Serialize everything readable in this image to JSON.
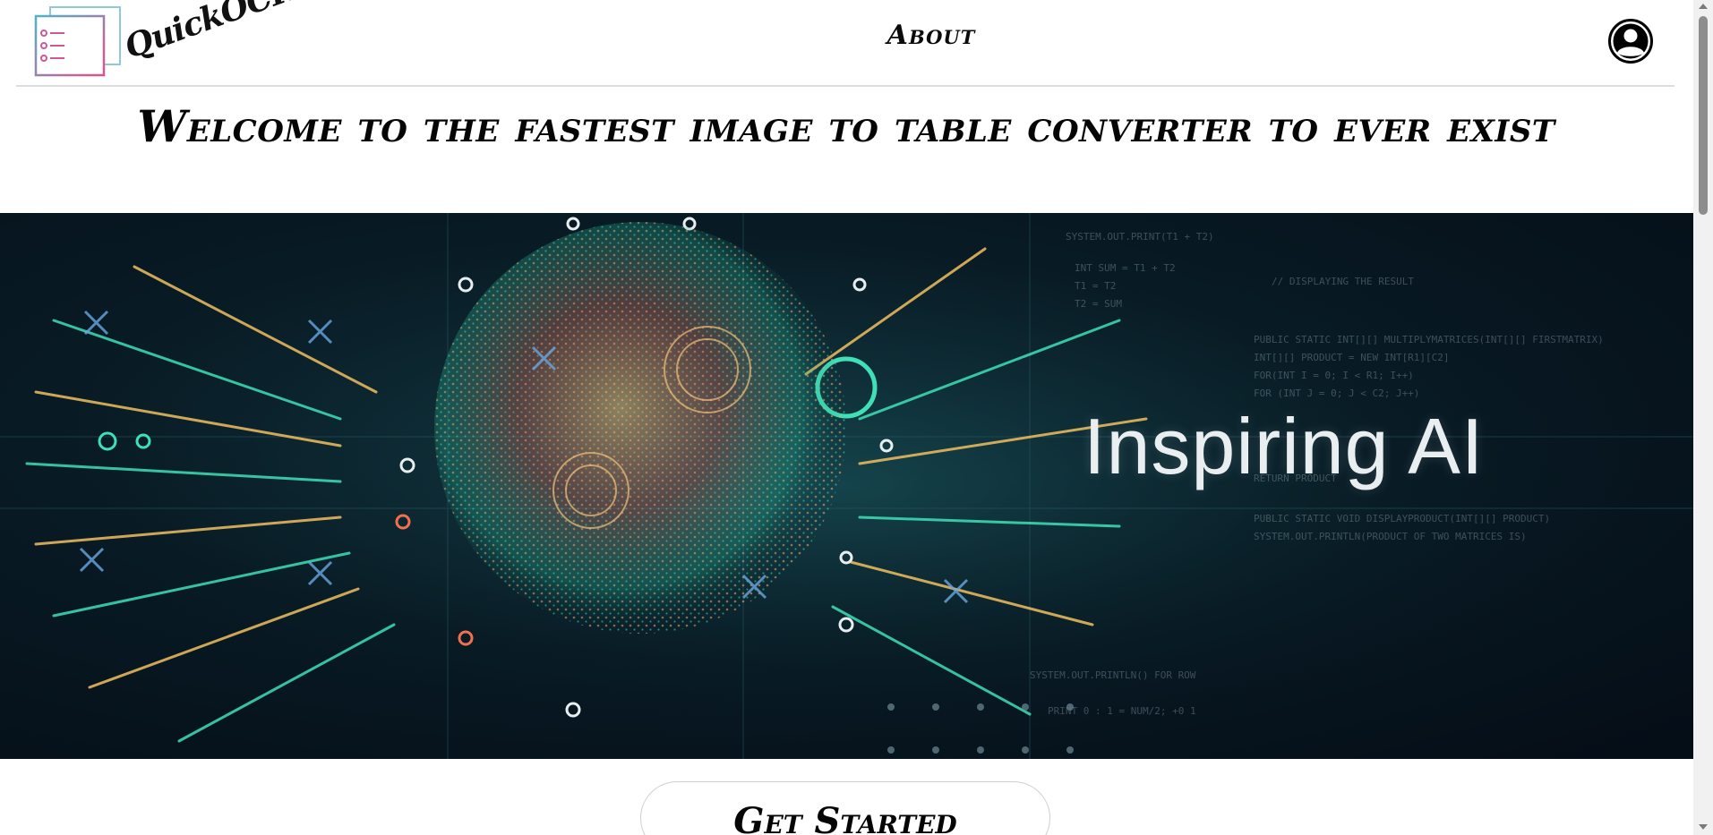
{
  "app": {
    "brand_name": "QuickOCR"
  },
  "nav": {
    "about_label": "About",
    "profile_icon": "user-circle-icon"
  },
  "headline": {
    "text": "Welcome to the fastest image to table converter to ever exist"
  },
  "hero": {
    "caption": "Inspiring AI",
    "image_icon": "ai-particle-sphere-image"
  },
  "cta": {
    "label": "Get Started"
  },
  "colors": {
    "logo_gradient_start": "#4fb3c8",
    "logo_gradient_end": "#e0508c",
    "text": "#050505",
    "hero_background": "#081a24",
    "hero_accent": "#2ee0b0"
  }
}
